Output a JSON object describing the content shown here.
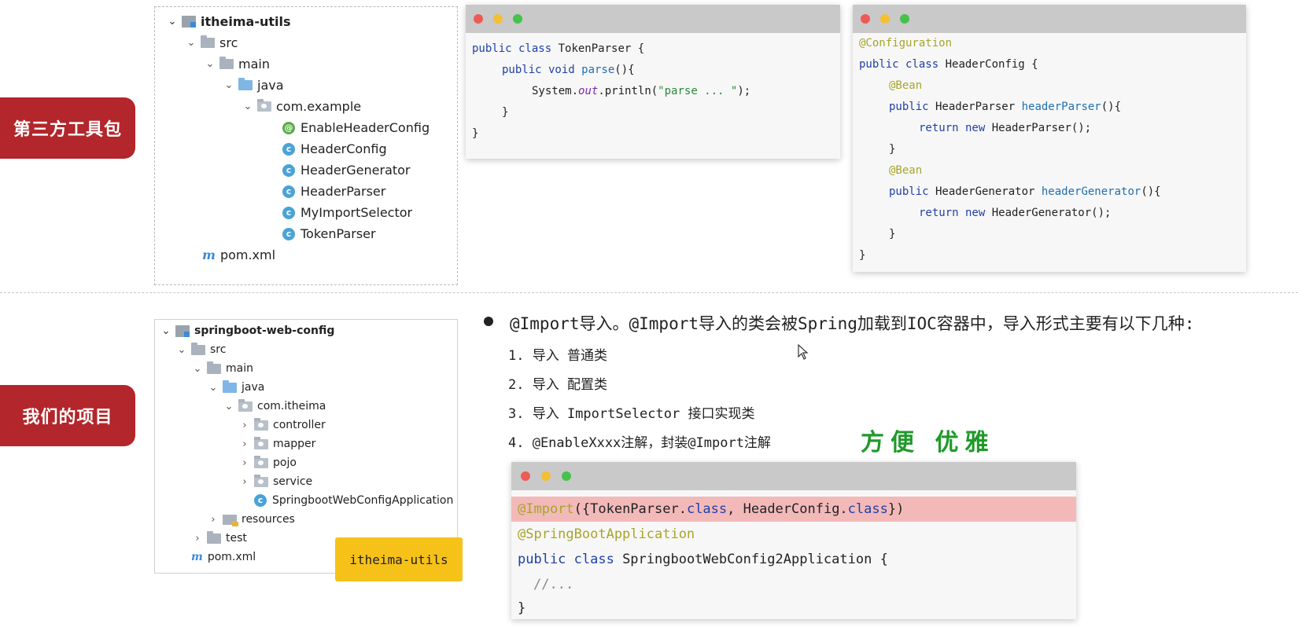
{
  "labels": {
    "third_party": "第三方工具包",
    "our_project": "我们的项目"
  },
  "tree_top": {
    "root": "itheima-utils",
    "src": "src",
    "main": "main",
    "java": "java",
    "package": "com.example",
    "classes": [
      "EnableHeaderConfig",
      "HeaderConfig",
      "HeaderGenerator",
      "HeaderParser",
      "MyImportSelector",
      "TokenParser"
    ],
    "pom": "pom.xml"
  },
  "tree_bottom": {
    "root": "springboot-web-config",
    "src": "src",
    "main": "main",
    "java": "java",
    "package": "com.itheima",
    "folders": [
      "controller",
      "mapper",
      "pojo",
      "service"
    ],
    "app_class": "SpringbootWebConfigApplication",
    "resources": "resources",
    "test": "test",
    "pom": "pom.xml"
  },
  "sticky_note": "itheima-utils",
  "token_parser_code": {
    "l1_kw": "public class",
    "l1_rest": " TokenParser {",
    "l2_kw": "public void",
    "l2_fn": " parse",
    "l2_rest": "(){",
    "l3_a": "System.",
    "l3_out": "out",
    "l3_b": ".println(",
    "l3_str": "\"parse ... \"",
    "l3_c": ");",
    "l4": "}",
    "l5": "}"
  },
  "header_config_code": {
    "l1": "@Configuration",
    "l2_kw": "public class",
    "l2_rest": " HeaderConfig {",
    "l3": "@Bean",
    "l4_kw": "public",
    "l4_type": " HeaderParser ",
    "l4_fn": "headerParser",
    "l4_rest": "(){",
    "l5_kw": "return new",
    "l5_rest": " HeaderParser();",
    "l6": "}",
    "l7": "@Bean",
    "l8_kw": "public",
    "l8_type": " HeaderGenerator ",
    "l8_fn": "headerGenerator",
    "l8_rest": "(){",
    "l9_kw": "return new",
    "l9_rest": " HeaderGenerator();",
    "l10": "}",
    "l11": "}"
  },
  "bullet": {
    "text": "@Import导入。@Import导入的类会被Spring加载到IOC容器中，导入形式主要有以下几种:",
    "items": [
      "1.  导入 普通类",
      "2.  导入 配置类",
      "3.  导入 ImportSelector 接口实现类",
      "4.  @EnableXxxx注解，封装@Import注解"
    ],
    "handwritten": "方便 优雅"
  },
  "app_code": {
    "l1_an": "@Import",
    "l1_a": "({TokenParser.",
    "l1_kw1": "class",
    "l1_b": ", HeaderConfig.",
    "l1_kw2": "class",
    "l1_c": "})",
    "l2": "@SpringBootApplication",
    "l3_kw": "public class",
    "l3_rest": " SpringbootWebConfig2Application {",
    "l4": "//...",
    "l5": "}"
  },
  "colors": {
    "label_red": "#b3262b",
    "sticky_yellow": "#f6c119",
    "highlight_pink": "#f3b9b9"
  }
}
